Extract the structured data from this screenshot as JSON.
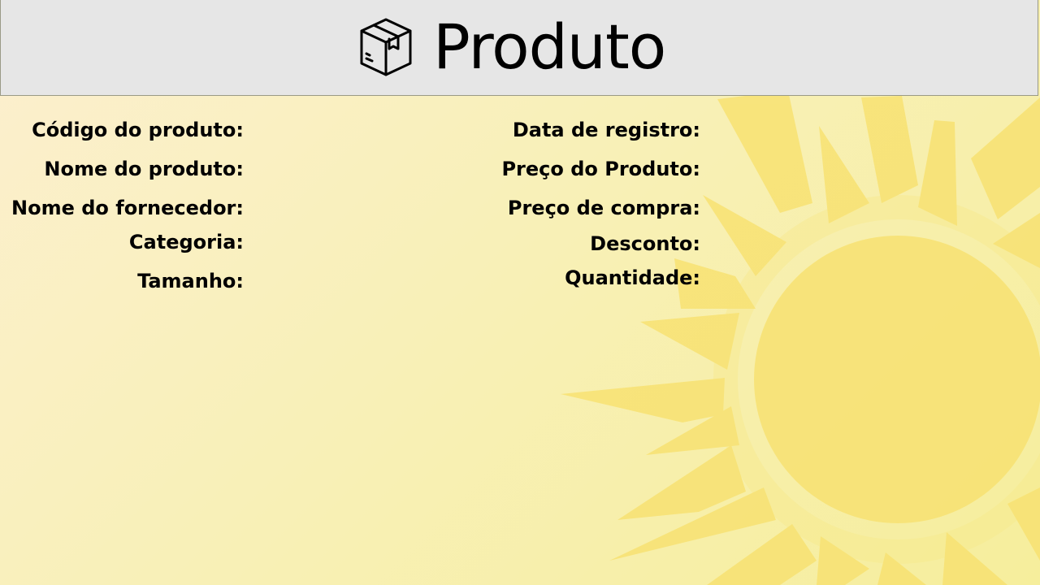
{
  "header": {
    "title": "Produto",
    "icon": "package-box-icon",
    "background": "#e6e6e6"
  },
  "background": {
    "decoration": "sun-icon",
    "colors": [
      "#fcefcf",
      "#f6ee9c",
      "#f7e36e"
    ]
  },
  "form": {
    "left_labels": {
      "codigo": "Código do produto:",
      "nome": "Nome do produto:",
      "fornecedor": "Nome do fornecedor:",
      "categoria": "Categoria:",
      "tamanho": "Tamanho:"
    },
    "right_labels": {
      "data_registro": "Data de registro:",
      "preco_produto": "Preço do Produto:",
      "preco_compra": "Preço de compra:",
      "desconto": "Desconto:",
      "quantidade": "Quantidade:"
    }
  }
}
